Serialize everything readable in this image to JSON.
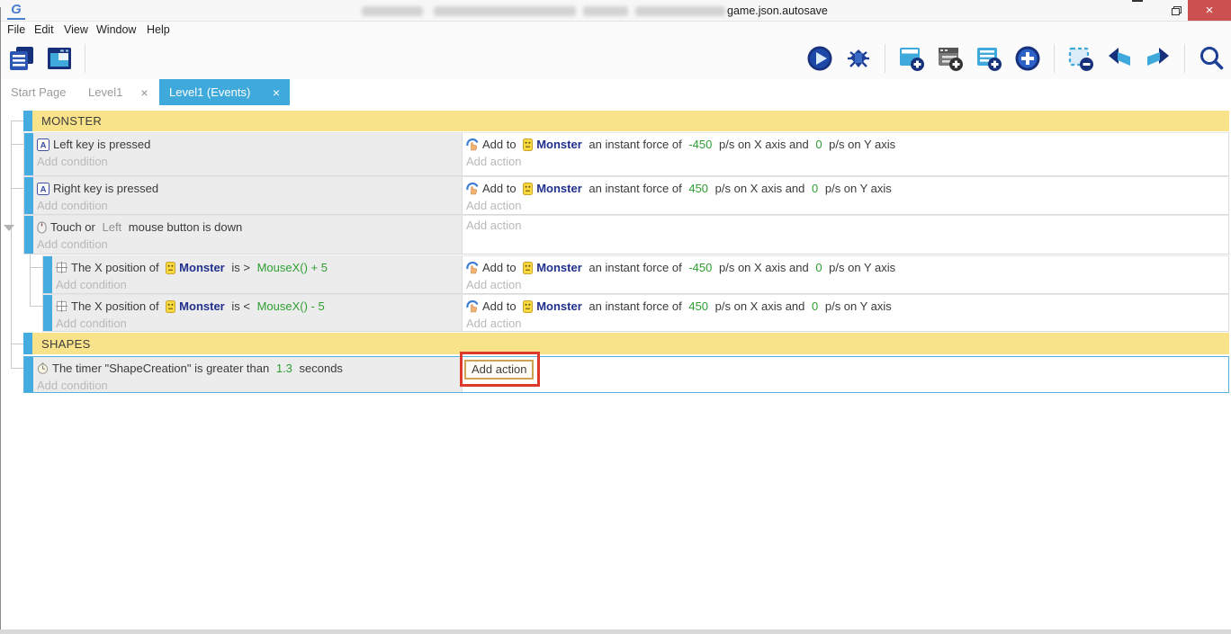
{
  "window": {
    "title": "game.json.autosave",
    "controls": {
      "minimize": "minimize",
      "restore": "restore",
      "close": "×"
    }
  },
  "menu": [
    "File",
    "Edit",
    "View",
    "Window",
    "Help"
  ],
  "toolbar": {
    "left": [
      {
        "name": "project-manager-icon"
      },
      {
        "name": "scene-editor-icon"
      }
    ],
    "right": [
      {
        "name": "preview-play-icon"
      },
      {
        "name": "debug-icon"
      },
      {
        "name": "add-event-icon"
      },
      {
        "name": "add-subevent-icon"
      },
      {
        "name": "add-comment-icon"
      },
      {
        "name": "add-circle-icon"
      },
      {
        "name": "deselect-icon"
      },
      {
        "name": "undo-icon"
      },
      {
        "name": "redo-icon"
      },
      {
        "name": "search-icon"
      }
    ]
  },
  "tabs": [
    {
      "label": "Start Page",
      "active": false,
      "close": ""
    },
    {
      "label": "Level1",
      "active": false,
      "close": "×"
    },
    {
      "label": "Level1 (Events)",
      "active": true,
      "close": "×"
    }
  ],
  "sheet": {
    "placeholders": {
      "condition": "Add condition",
      "action": "Add action"
    },
    "events": [
      {
        "kind": "group",
        "label": "MONSTER"
      },
      {
        "kind": "event",
        "conditions": [
          {
            "icon": "keyboard-icon",
            "segments": [
              {
                "text": "Left key is pressed",
                "style": "plain"
              }
            ]
          }
        ],
        "actions": [
          {
            "icon": "force-icon",
            "segments": [
              {
                "text": "Add to ",
                "style": "plain"
              },
              {
                "icon": "monster-object-icon"
              },
              {
                "text": "Monster",
                "style": "object"
              },
              {
                "text": " an instant force of ",
                "style": "plain"
              },
              {
                "text": "-450",
                "style": "expr"
              },
              {
                "text": " p/s on X axis and ",
                "style": "plain"
              },
              {
                "text": "0",
                "style": "expr"
              },
              {
                "text": " p/s on Y axis",
                "style": "plain"
              }
            ]
          }
        ]
      },
      {
        "kind": "event",
        "conditions": [
          {
            "icon": "keyboard-icon",
            "segments": [
              {
                "text": "Right key is pressed",
                "style": "plain"
              }
            ]
          }
        ],
        "actions": [
          {
            "icon": "force-icon",
            "segments": [
              {
                "text": "Add to ",
                "style": "plain"
              },
              {
                "icon": "monster-object-icon"
              },
              {
                "text": "Monster",
                "style": "object"
              },
              {
                "text": " an instant force of ",
                "style": "plain"
              },
              {
                "text": "450",
                "style": "expr"
              },
              {
                "text": " p/s on X axis and ",
                "style": "plain"
              },
              {
                "text": "0",
                "style": "expr"
              },
              {
                "text": " p/s on Y axis",
                "style": "plain"
              }
            ]
          }
        ]
      },
      {
        "kind": "event",
        "conditions": [
          {
            "icon": "mouse-icon",
            "segments": [
              {
                "text": "Touch or ",
                "style": "plain"
              },
              {
                "text": "Left",
                "style": "param"
              },
              {
                "text": " mouse button is down",
                "style": "plain"
              }
            ]
          }
        ],
        "actions": []
      },
      {
        "kind": "event",
        "sub": true,
        "conditions": [
          {
            "icon": "position-icon",
            "segments": [
              {
                "text": "The X position of ",
                "style": "plain"
              },
              {
                "icon": "monster-object-icon"
              },
              {
                "text": "Monster",
                "style": "object"
              },
              {
                "text": " is > ",
                "style": "plain"
              },
              {
                "text": "MouseX() + 5",
                "style": "expr"
              }
            ]
          }
        ],
        "actions": [
          {
            "icon": "force-icon",
            "segments": [
              {
                "text": "Add to ",
                "style": "plain"
              },
              {
                "icon": "monster-object-icon"
              },
              {
                "text": "Monster",
                "style": "object"
              },
              {
                "text": " an instant force of ",
                "style": "plain"
              },
              {
                "text": "-450",
                "style": "expr"
              },
              {
                "text": " p/s on X axis and ",
                "style": "plain"
              },
              {
                "text": "0",
                "style": "expr"
              },
              {
                "text": " p/s on Y axis",
                "style": "plain"
              }
            ]
          }
        ]
      },
      {
        "kind": "event",
        "sub": true,
        "conditions": [
          {
            "icon": "position-icon",
            "segments": [
              {
                "text": "The X position of ",
                "style": "plain"
              },
              {
                "icon": "monster-object-icon"
              },
              {
                "text": "Monster",
                "style": "object"
              },
              {
                "text": " is < ",
                "style": "plain"
              },
              {
                "text": "MouseX() - 5",
                "style": "expr"
              }
            ]
          }
        ],
        "actions": [
          {
            "icon": "force-icon",
            "segments": [
              {
                "text": "Add to ",
                "style": "plain"
              },
              {
                "icon": "monster-object-icon"
              },
              {
                "text": "Monster",
                "style": "object"
              },
              {
                "text": " an instant force of ",
                "style": "plain"
              },
              {
                "text": "450",
                "style": "expr"
              },
              {
                "text": " p/s on X axis and ",
                "style": "plain"
              },
              {
                "text": "0",
                "style": "expr"
              },
              {
                "text": " p/s on Y axis",
                "style": "plain"
              }
            ]
          }
        ]
      },
      {
        "kind": "group",
        "label": "SHAPES"
      },
      {
        "kind": "event",
        "selected": true,
        "conditions": [
          {
            "icon": "timer-icon",
            "segments": [
              {
                "text": "The timer \"ShapeCreation\" is greater than ",
                "style": "plain"
              },
              {
                "text": "1.3",
                "style": "expr"
              },
              {
                "text": " seconds",
                "style": "plain"
              }
            ]
          }
        ],
        "actions": []
      }
    ]
  },
  "colors": {
    "accent_blue": "#3fa9dc",
    "event_bar_blue": "#45ace2",
    "group_yellow": "#f9e38a",
    "expression_green": "#2f9e31",
    "object_navy": "#20308d",
    "close_red": "#cb5151",
    "annotation_red": "#de3a2c",
    "focus_border_tan": "#cfa254"
  }
}
